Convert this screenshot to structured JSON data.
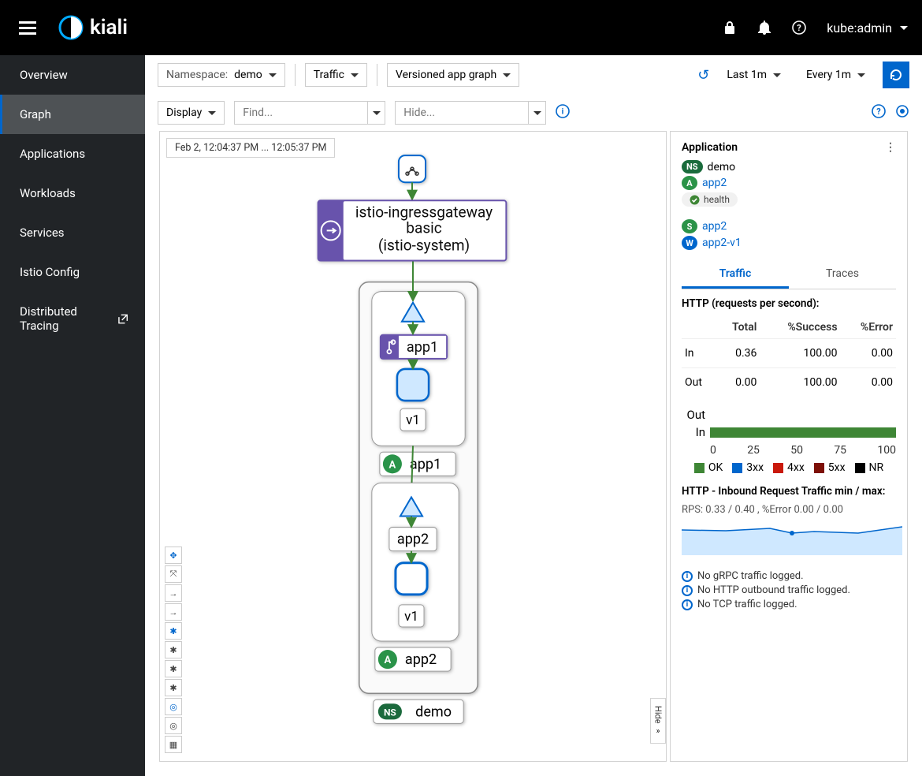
{
  "brand": "kiali",
  "user": "kube:admin",
  "sidebar": {
    "items": [
      {
        "label": "Overview"
      },
      {
        "label": "Graph"
      },
      {
        "label": "Applications"
      },
      {
        "label": "Workloads"
      },
      {
        "label": "Services"
      },
      {
        "label": "Istio Config"
      },
      {
        "label": "Distributed Tracing"
      }
    ],
    "active": 1
  },
  "toolbar": {
    "namespace_label": "Namespace:",
    "namespace_value": "demo",
    "traffic_dropdown": "Traffic",
    "graph_type": "Versioned app graph",
    "time_range": "Last 1m",
    "refresh_interval": "Every 1m",
    "display_dropdown": "Display",
    "find_placeholder": "Find...",
    "hide_placeholder": "Hide..."
  },
  "graph": {
    "timestamp": "Feb 2, 12:04:37 PM ... 12:05:37 PM",
    "ingress": {
      "line1": "istio-ingressgateway",
      "line2": "basic",
      "line3": "(istio-system)"
    },
    "app1": {
      "name": "app1",
      "version": "v1",
      "footer": "app1"
    },
    "app2": {
      "name": "app2",
      "version": "v1",
      "footer": "app2"
    },
    "ns_footer": "demo",
    "hide_label": "Hide"
  },
  "panel": {
    "title": "Application",
    "ns": "demo",
    "app": "app2",
    "health_label": "health",
    "svc": "app2",
    "workload": "app2-v1",
    "tabs": {
      "traffic": "Traffic",
      "traces": "Traces"
    },
    "http_header": "HTTP (requests per second):",
    "table": {
      "headers": [
        "",
        "Total",
        "%Success",
        "%Error"
      ],
      "rows": [
        {
          "dir": "In",
          "total": "0.36",
          "success": "100.00",
          "error": "0.00"
        },
        {
          "dir": "Out",
          "total": "0.00",
          "success": "100.00",
          "error": "0.00"
        }
      ]
    },
    "chart_data": {
      "type": "bar",
      "orientation": "horizontal-stacked",
      "categories": [
        "Out",
        "In"
      ],
      "series": [
        {
          "name": "OK",
          "color": "#3e8635",
          "values": [
            0,
            100
          ]
        },
        {
          "name": "3xx",
          "color": "#06c",
          "values": [
            0,
            0
          ]
        },
        {
          "name": "4xx",
          "color": "#c9190b",
          "values": [
            0,
            0
          ]
        },
        {
          "name": "5xx",
          "color": "#7d1007",
          "values": [
            0,
            0
          ]
        },
        {
          "name": "NR",
          "color": "#000",
          "values": [
            0,
            0
          ]
        }
      ],
      "xlim": [
        0,
        100
      ],
      "xticks": [
        0,
        25,
        50,
        75,
        100
      ]
    },
    "inbound_header": "HTTP - Inbound Request Traffic min / max:",
    "inbound_detail": "RPS: 0.33 / 0.40 , %Error 0.00 / 0.00",
    "sparkline": {
      "type": "area",
      "points": [
        0.35,
        0.35,
        0.38,
        0.34,
        0.33,
        0.4
      ],
      "ylim": [
        0,
        0.5
      ]
    },
    "notes": [
      "No gRPC traffic logged.",
      "No HTTP outbound traffic logged.",
      "No TCP traffic logged."
    ]
  }
}
